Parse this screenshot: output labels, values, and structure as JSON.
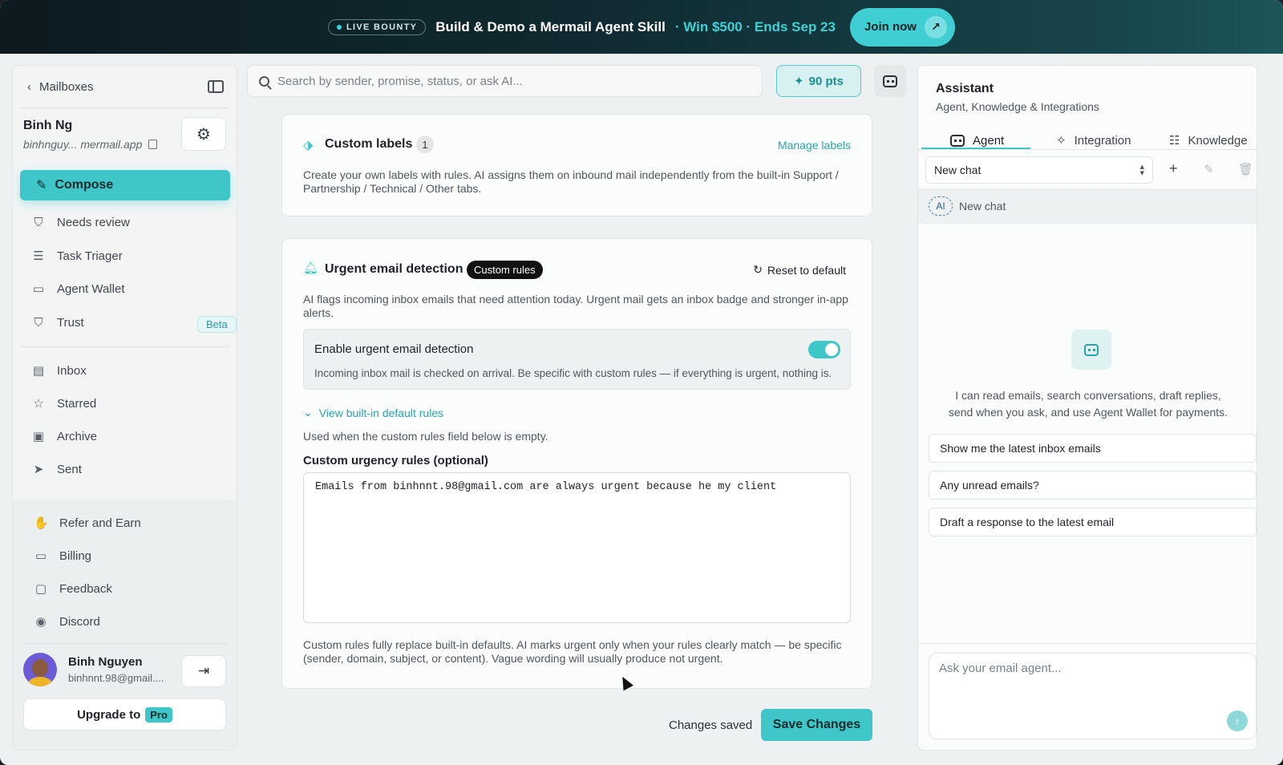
{
  "banner": {
    "live_label": "LIVE BOUNTY",
    "title": "Build & Demo a Mermail Agent Skill",
    "accent": "· Win $500 · Ends Sep 23",
    "join_label": "Join now"
  },
  "sidebar": {
    "back_label": "Mailboxes",
    "user_name": "Binh Ng",
    "user_email": "binhnguy... mermail.app",
    "compose_label": "Compose",
    "nav_items": [
      {
        "label": "Needs review",
        "icon": "shield-check-icon"
      },
      {
        "label": "Task Triager",
        "icon": "checklist-icon"
      },
      {
        "label": "Agent Wallet",
        "icon": "wallet-icon"
      },
      {
        "label": "Trust",
        "icon": "shield-icon",
        "badge": "Beta"
      }
    ],
    "mail_items": [
      {
        "label": "Inbox",
        "icon": "inbox-icon"
      },
      {
        "label": "Starred",
        "icon": "star-icon"
      },
      {
        "label": "Archive",
        "icon": "archive-icon"
      },
      {
        "label": "Sent",
        "icon": "send-icon"
      }
    ],
    "bottom_items": [
      {
        "label": "Refer and Earn",
        "icon": "handshake-icon"
      },
      {
        "label": "Billing",
        "icon": "billing-icon"
      },
      {
        "label": "Feedback",
        "icon": "feedback-icon"
      },
      {
        "label": "Discord",
        "icon": "discord-icon"
      }
    ],
    "profile_name": "Binh Nguyen",
    "profile_email": "binhnnt.98@gmail....",
    "upgrade_label": "Upgrade to",
    "pro_label": "Pro"
  },
  "search": {
    "placeholder": "Search by sender, promise, status, or ask AI...",
    "points_label": "90 pts"
  },
  "labels_card": {
    "title": "Custom labels",
    "count": "1",
    "manage_label": "Manage labels",
    "description": "Create your own labels with rules. AI assigns them on inbound mail independently from the built-in Support / Partnership / Technical / Other tabs."
  },
  "urgent_card": {
    "title": "Urgent email detection",
    "badge": "Custom rules",
    "reset_label": "Reset to default",
    "description": "AI flags incoming inbox emails that need attention today. Urgent mail gets an inbox badge and stronger in-app alerts.",
    "toggle_title": "Enable urgent email detection",
    "toggle_desc": "Incoming inbox mail is checked on arrival. Be specific with custom rules — if everything is urgent, nothing is.",
    "toggle_on": true,
    "view_rules_label": "View built-in default rules",
    "used_when": "Used when the custom rules field below is empty.",
    "rules_label": "Custom urgency rules (optional)",
    "rules_value": "Emails from binhnnt.98@gmail.com are always urgent because he my client",
    "footer_note": "Custom rules fully replace built-in defaults. AI marks urgent only when your rules clearly match — be specific (sender, domain, subject, or content). Vague wording will usually produce not urgent."
  },
  "actions": {
    "status": "Changes saved",
    "save_label": "Save Changes"
  },
  "assistant": {
    "title": "Assistant",
    "subtitle": "Agent, Knowledge & Integrations",
    "tabs": [
      {
        "label": "Agent",
        "icon": "robot-icon"
      },
      {
        "label": "Integration",
        "icon": "puzzle-icon"
      },
      {
        "label": "Knowledge",
        "icon": "database-icon"
      }
    ],
    "chat_select": "New chat",
    "chat_badge": "AI",
    "chat_row": "New chat",
    "empty_text": "I can read emails, search conversations, draft replies, send when you ask, and use Agent Wallet for payments.",
    "suggestions": [
      "Show me the latest inbox emails",
      "Any unread emails?",
      "Draft a response to the latest email"
    ],
    "input_placeholder": "Ask your email agent..."
  },
  "colors": {
    "accent": "#3ec6c9",
    "link": "#2aa6ab"
  }
}
